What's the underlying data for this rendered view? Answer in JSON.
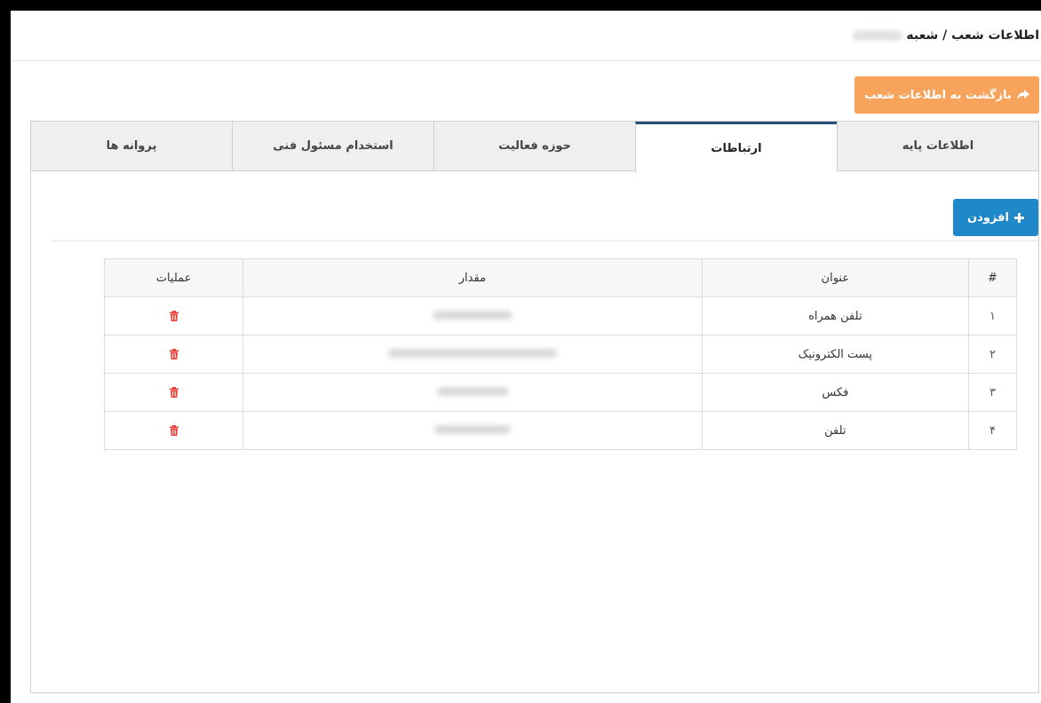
{
  "header": {
    "breadcrumb": "اطلاعات شعب / شعبه"
  },
  "back_button": {
    "label": "بازگشت به اطلاعات شعب",
    "icon": "reply-arrow-icon"
  },
  "tabs": [
    {
      "label": "اطلاعات پایه",
      "active": false
    },
    {
      "label": "ارتباطات",
      "active": true
    },
    {
      "label": "حوزه فعالیت",
      "active": false
    },
    {
      "label": "استخدام مسئول فنی",
      "active": false
    },
    {
      "label": "پروانه ها",
      "active": false
    }
  ],
  "add_button": {
    "label": "افزودن",
    "icon": "plus-icon"
  },
  "table": {
    "headers": {
      "num": "#",
      "title": "عنوان",
      "value": "مقدار",
      "ops": "عملیات"
    },
    "rows": [
      {
        "num": "۱",
        "title": "تلفن همراه"
      },
      {
        "num": "۲",
        "title": "پست الکترونیک"
      },
      {
        "num": "۳",
        "title": "فکس"
      },
      {
        "num": "۴",
        "title": "تلفن"
      }
    ]
  },
  "colors": {
    "back_button": "#f7a35c",
    "add_button": "#1e88c9",
    "active_tab_border": "#2a4f7a",
    "delete_icon": "#e8413b"
  }
}
